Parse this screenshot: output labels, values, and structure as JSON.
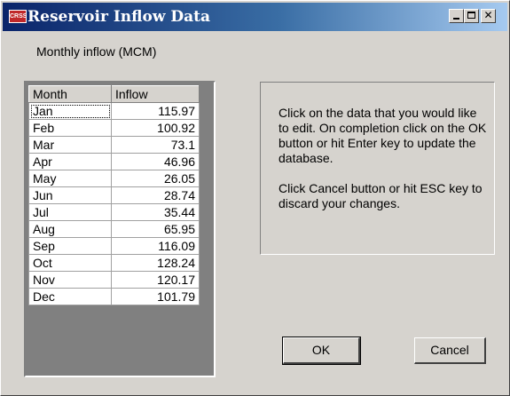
{
  "window": {
    "title": "Reservoir Inflow Data",
    "icon_text": "CRSS",
    "controls": {
      "minimize": "minimize-icon",
      "maximize": "maximize-icon",
      "close": "close-icon"
    }
  },
  "caption": "Monthly inflow (MCM)",
  "table": {
    "columns": [
      "Month",
      "Inflow"
    ],
    "rows": [
      {
        "month": "Jan",
        "inflow": "115.97"
      },
      {
        "month": "Feb",
        "inflow": "100.92"
      },
      {
        "month": "Mar",
        "inflow": "73.1"
      },
      {
        "month": "Apr",
        "inflow": "46.96"
      },
      {
        "month": "May",
        "inflow": "26.05"
      },
      {
        "month": "Jun",
        "inflow": "28.74"
      },
      {
        "month": "Jul",
        "inflow": "35.44"
      },
      {
        "month": "Aug",
        "inflow": "65.95"
      },
      {
        "month": "Sep",
        "inflow": "116.09"
      },
      {
        "month": "Oct",
        "inflow": "128.24"
      },
      {
        "month": "Nov",
        "inflow": "120.17"
      },
      {
        "month": "Dec",
        "inflow": "101.79"
      }
    ]
  },
  "instructions": {
    "paragraph1": "Click on the data that you would like to edit. On completion click on the OK button or hit Enter key to update the database.",
    "paragraph2": "Click Cancel button or hit ESC key to discard your changes."
  },
  "buttons": {
    "ok": "OK",
    "cancel": "Cancel"
  },
  "colors": {
    "titlebar_start": "#0a246a",
    "titlebar_end": "#a6caf0",
    "face": "#d6d3ce"
  }
}
